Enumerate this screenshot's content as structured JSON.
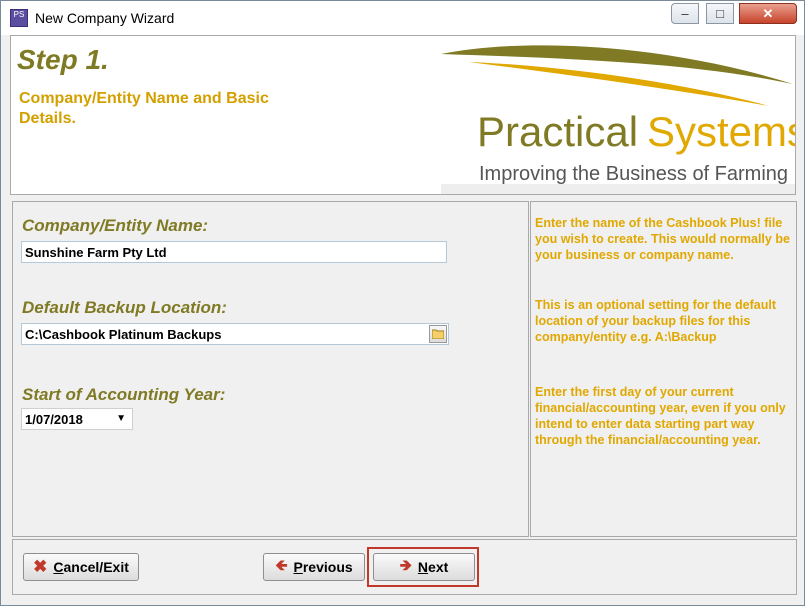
{
  "window": {
    "title": "New Company Wizard",
    "app_icon_text": "PS"
  },
  "header": {
    "step_title": "Step 1.",
    "step_subtitle": "Company/Entity Name and Basic Details.",
    "logo": {
      "name": "Practical Systems",
      "tagline": "Improving the Business of Farming"
    }
  },
  "form": {
    "company_name": {
      "label": "Company/Entity Name:",
      "value": "Sunshine Farm Pty Ltd"
    },
    "backup_location": {
      "label": "Default Backup Location:",
      "value": "C:\\Cashbook Platinum Backups"
    },
    "accounting_year": {
      "label": "Start of Accounting Year:",
      "value": "1/07/2018"
    }
  },
  "help": {
    "company_name": "Enter the name of the Cashbook Plus! file you wish to create. This would normally be your business or company name.",
    "backup_location": "This is an optional setting for the default location of your backup files for this company/entity e.g. A:\\Backup",
    "accounting_year": "Enter the first day of your current financial/accounting year, even if you only intend to enter data starting part way through the financial/accounting year."
  },
  "buttons": {
    "cancel": {
      "accel": "C",
      "rest": "ancel/Exit"
    },
    "previous": {
      "accel": "P",
      "rest": "revious"
    },
    "next": {
      "accel": "N",
      "rest": "ext"
    }
  },
  "colors": {
    "olive": "#7f7a23",
    "gold": "#d4a000",
    "cancel_red": "#c0392b"
  }
}
